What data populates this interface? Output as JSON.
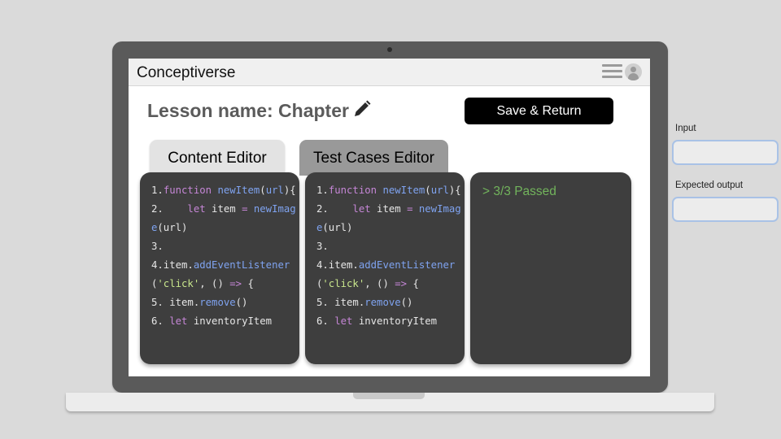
{
  "app": {
    "title": "Conceptiverse"
  },
  "header": {
    "lesson_label": "Lesson name: Chapter",
    "save_label": "Save & Return"
  },
  "tabs": [
    {
      "label": "Content Editor"
    },
    {
      "label": "Test Cases Editor"
    }
  ],
  "code_lines": [
    [
      {
        "t": "1.",
        "c": ""
      },
      {
        "t": "function",
        "c": "kw"
      },
      {
        "t": " ",
        "c": ""
      },
      {
        "t": "newItem",
        "c": "fn"
      },
      {
        "t": "(",
        "c": ""
      },
      {
        "t": "url",
        "c": "fn"
      },
      {
        "t": "){",
        "c": ""
      }
    ],
    [
      {
        "t": "2.    ",
        "c": ""
      },
      {
        "t": "let",
        "c": "kw"
      },
      {
        "t": " item ",
        "c": ""
      },
      {
        "t": "=",
        "c": "kw"
      },
      {
        "t": " ",
        "c": ""
      },
      {
        "t": "newImage",
        "c": "fn"
      },
      {
        "t": "(url)",
        "c": ""
      }
    ],
    [
      {
        "t": "3.",
        "c": ""
      }
    ],
    [
      {
        "t": "4.item.",
        "c": ""
      },
      {
        "t": "addEventListener",
        "c": "fn"
      },
      {
        "t": "(",
        "c": ""
      },
      {
        "t": "'click'",
        "c": "str"
      },
      {
        "t": ", () ",
        "c": ""
      },
      {
        "t": "=>",
        "c": "kw"
      },
      {
        "t": " {",
        "c": ""
      }
    ],
    [
      {
        "t": "5. item.",
        "c": ""
      },
      {
        "t": "remove",
        "c": "fn"
      },
      {
        "t": "()",
        "c": ""
      }
    ],
    [
      {
        "t": "6. ",
        "c": ""
      },
      {
        "t": "let",
        "c": "kw"
      },
      {
        "t": " inventoryItem",
        "c": ""
      }
    ]
  ],
  "result": {
    "text": "> 3/3 Passed",
    "color": "#72b45c"
  },
  "side": {
    "input_label": "Input",
    "input_value": "",
    "expected_label": "Expected output",
    "expected_value": ""
  },
  "colors": {
    "keyword": "#c586d6",
    "function": "#7fa3f0",
    "string": "#c8e68c",
    "panel": "#3e3e3e"
  },
  "icons": {
    "edit": "pencil-icon",
    "menu": "hamburger-menu-icon",
    "profile": "avatar-icon"
  }
}
